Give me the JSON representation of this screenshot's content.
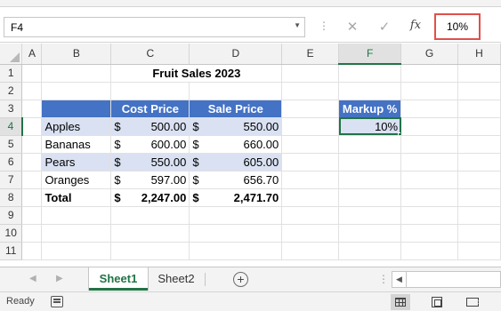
{
  "name_box": {
    "value": "F4"
  },
  "formula_bar": {
    "value": "10%"
  },
  "columns": [
    "A",
    "B",
    "C",
    "D",
    "E",
    "F",
    "G",
    "H"
  ],
  "rows": [
    "1",
    "2",
    "3",
    "4",
    "5",
    "6",
    "7",
    "8",
    "9",
    "10",
    "11"
  ],
  "sheet": {
    "title": "Fruit Sales 2023",
    "headers": {
      "cost": "Cost Price",
      "sale": "Sale Price",
      "markup": "Markup %"
    },
    "currency": "$",
    "items": [
      {
        "name": "Apples",
        "cost": "500.00",
        "sale": "550.00"
      },
      {
        "name": "Bananas",
        "cost": "600.00",
        "sale": "660.00"
      },
      {
        "name": "Pears",
        "cost": "550.00",
        "sale": "605.00"
      },
      {
        "name": "Oranges",
        "cost": "597.00",
        "sale": "656.70"
      }
    ],
    "total": {
      "label": "Total",
      "cost": "2,247.00",
      "sale": "2,471.70"
    },
    "markup_value": "10%"
  },
  "tabs": [
    "Sheet1",
    "Sheet2"
  ],
  "status": {
    "text": "Ready"
  },
  "colors": {
    "accent": "#217346",
    "table_header": "#4472c4",
    "band": "#d9e1f2",
    "highlight_box": "#e0504a"
  }
}
